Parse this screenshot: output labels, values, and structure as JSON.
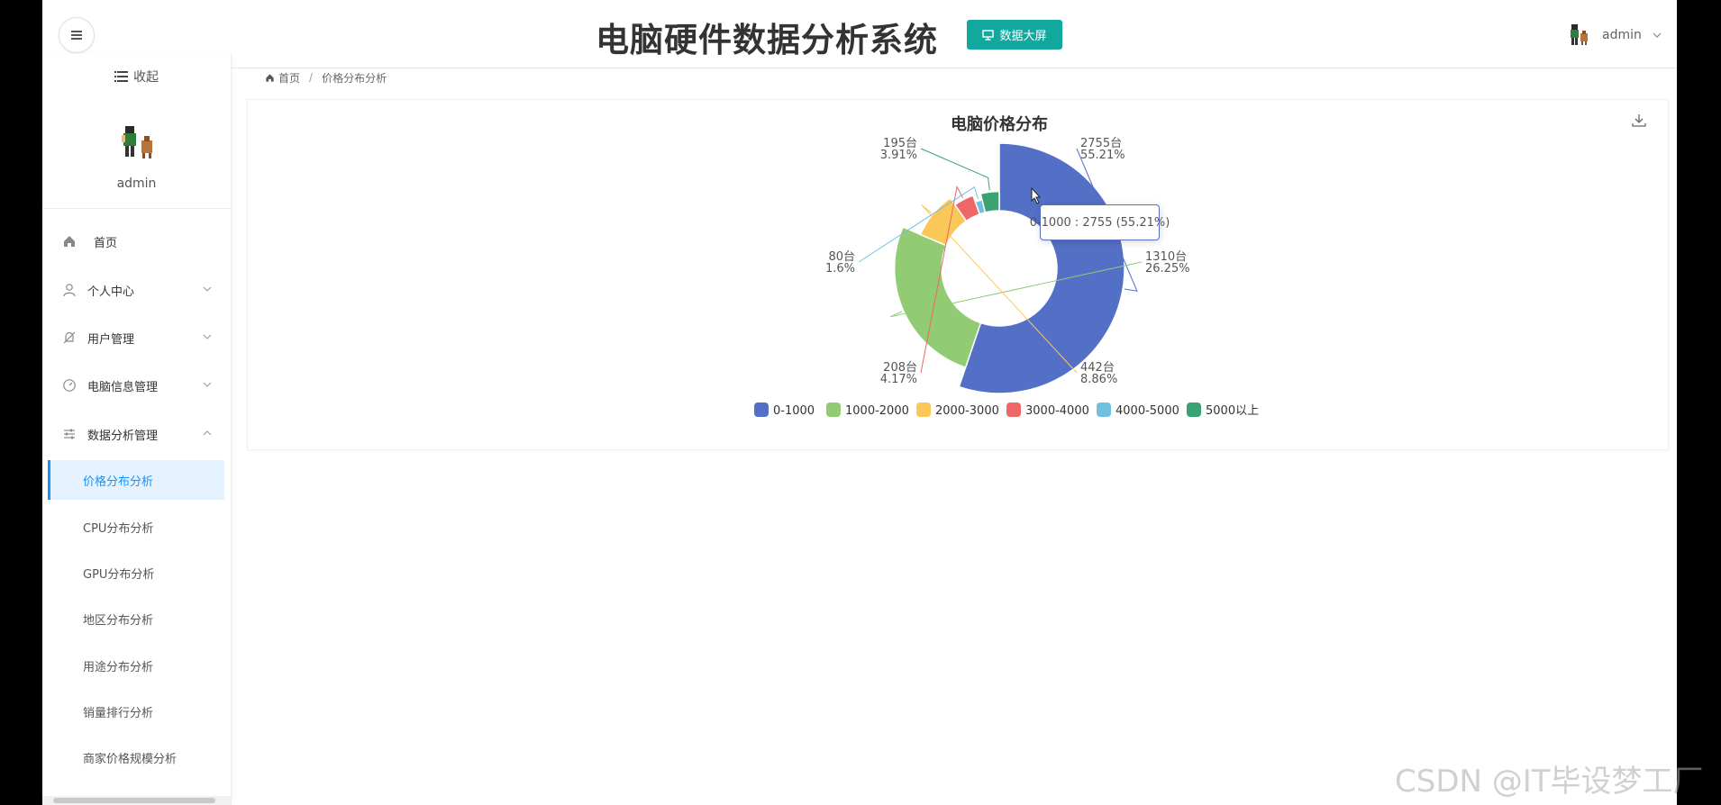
{
  "header": {
    "title": "电脑硬件数据分析系统",
    "bigscreen_label": "数据大屏",
    "user_name": "admin"
  },
  "sidebar": {
    "collapse_label": "收起",
    "user_name": "admin",
    "menu": [
      {
        "label": "首页",
        "icon": "home-icon"
      },
      {
        "label": "个人中心",
        "icon": "user-icon"
      },
      {
        "label": "用户管理",
        "icon": "bell-off-icon"
      },
      {
        "label": "电脑信息管理",
        "icon": "gauge-icon"
      },
      {
        "label": "数据分析管理",
        "icon": "sliders-icon"
      }
    ],
    "submenu": [
      {
        "label": "价格分布分析",
        "active": true
      },
      {
        "label": "CPU分布分析"
      },
      {
        "label": "GPU分布分析"
      },
      {
        "label": "地区分布分析"
      },
      {
        "label": "用途分布分析"
      },
      {
        "label": "销量排行分析"
      },
      {
        "label": "商家价格规模分析"
      }
    ]
  },
  "breadcrumb": {
    "home": "首页",
    "separator": "/",
    "current": "价格分布分析"
  },
  "tooltip": {
    "text": "0-1000 : 2755 (55.21%)"
  },
  "watermark": "CSDN @IT毕设梦工厂",
  "chart_data": {
    "type": "pie",
    "subtype": "nightingale-rose-donut",
    "title": "电脑价格分布",
    "legend_position": "bottom",
    "unit": "台",
    "categories": [
      "0-1000",
      "1000-2000",
      "2000-3000",
      "3000-4000",
      "4000-5000",
      "5000以上"
    ],
    "values": [
      2755,
      1310,
      442,
      208,
      80,
      195
    ],
    "percents": [
      "55.21%",
      "26.25%",
      "8.86%",
      "4.17%",
      "1.6%",
      "3.91%"
    ],
    "labels": [
      {
        "count": "2755台",
        "percent": "55.21%"
      },
      {
        "count": "1310台",
        "percent": "26.25%"
      },
      {
        "count": "442台",
        "percent": "8.86%"
      },
      {
        "count": "208台",
        "percent": "4.17%"
      },
      {
        "count": "80台",
        "percent": "1.6%"
      },
      {
        "count": "195台",
        "percent": "3.91%"
      }
    ],
    "colors": [
      "#5470c6",
      "#91cc75",
      "#fac858",
      "#ee6666",
      "#73c0de",
      "#3ba272"
    ]
  }
}
